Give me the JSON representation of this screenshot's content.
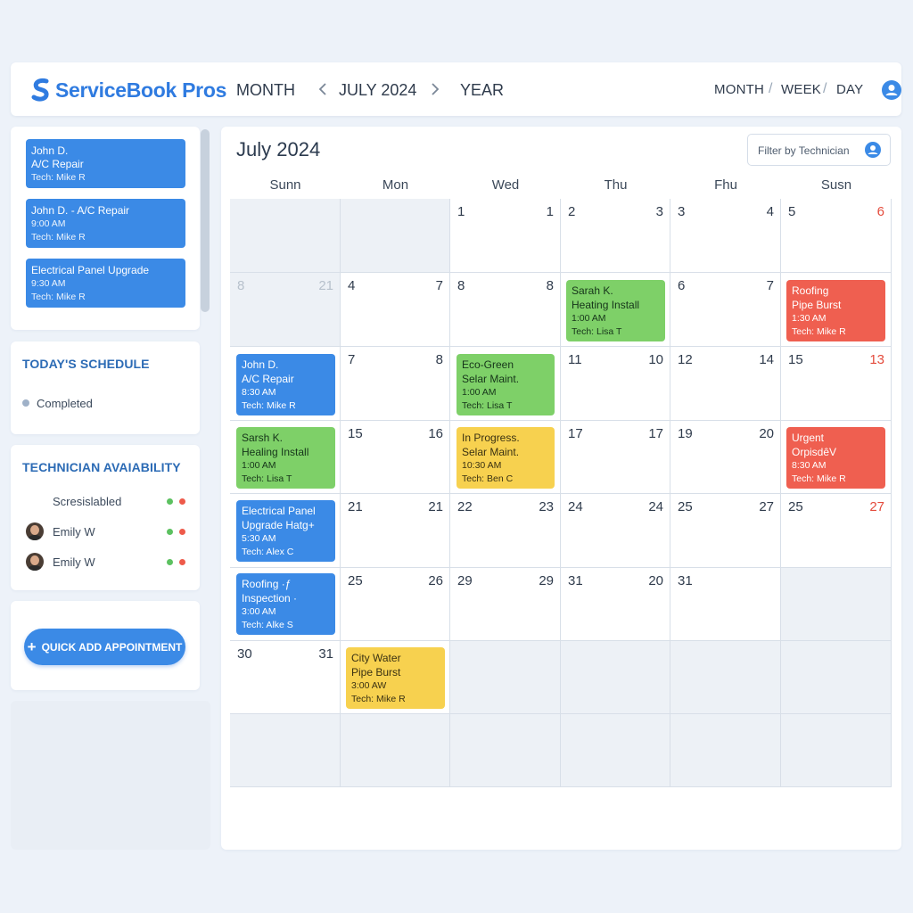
{
  "header": {
    "brand": "ServiceBook Pros",
    "nav_month": "MONTH",
    "nav_current": "JULY 2024",
    "nav_year": "YEAR",
    "view_month": "MONTH",
    "view_week": "WEEK",
    "view_day": "DAY",
    "separator": "/"
  },
  "sidebar": {
    "upcoming": [
      {
        "line1": "John D.",
        "line2": "A/C Repair",
        "line3": "Tech: Mike R"
      },
      {
        "line1": "John D. - A/C Repair",
        "line2": "9:00 AM",
        "line3": "Tech: Mike R"
      },
      {
        "line1": "Electrical Panel Upgrade",
        "line2": "9:30 AM",
        "line3": "Tech: Mike R"
      }
    ],
    "todays_schedule_title": "TODAY'S SCHEDULE",
    "status_completed": "Completed",
    "technician_title": "TECHNICIAN AVAIABILITY",
    "technicians": [
      {
        "name": "Scresislabled"
      },
      {
        "name": "Emily W"
      },
      {
        "name": "Emily W"
      }
    ],
    "quick_add": "QUICK ADD APPOINTMENT"
  },
  "calendar": {
    "title": "July 2024",
    "filter_label": "Filter by Technician",
    "days_of_week": [
      "Sunn",
      "Mon",
      "Wed",
      "Thu",
      "Fhu",
      "Susn"
    ],
    "cells": [
      {
        "l": "",
        "r": ""
      },
      {
        "l": "",
        "r": ""
      },
      {
        "l": "1",
        "r": "1"
      },
      {
        "l": "2",
        "r": "3"
      },
      {
        "l": "3",
        "r": "4"
      },
      {
        "l": "5",
        "r": "6"
      },
      {
        "l": "8",
        "r": "21"
      },
      {
        "l": "4",
        "r": "7"
      },
      {
        "l": "8",
        "r": "8"
      },
      {
        "l": "",
        "r": ""
      },
      {
        "l": "6",
        "r": "7"
      },
      {
        "l": "",
        "r": ""
      },
      {
        "l": "",
        "r": ""
      },
      {
        "l": "7",
        "r": "8"
      },
      {
        "l": "",
        "r": ""
      },
      {
        "l": "11",
        "r": "10"
      },
      {
        "l": "12",
        "r": "14"
      },
      {
        "l": "15",
        "r": "13"
      },
      {
        "l": "",
        "r": ""
      },
      {
        "l": "15",
        "r": "16"
      },
      {
        "l": "",
        "r": ""
      },
      {
        "l": "17",
        "r": "17"
      },
      {
        "l": "19",
        "r": "20"
      },
      {
        "l": "",
        "r": ""
      },
      {
        "l": "",
        "r": ""
      },
      {
        "l": "21",
        "r": "21"
      },
      {
        "l": "22",
        "r": "23"
      },
      {
        "l": "24",
        "r": "24"
      },
      {
        "l": "25",
        "r": "27"
      },
      {
        "l": "25",
        "r": "27"
      },
      {
        "l": "",
        "r": ""
      },
      {
        "l": "25",
        "r": "26"
      },
      {
        "l": "29",
        "r": "29"
      },
      {
        "l": "31",
        "r": "20"
      },
      {
        "l": "31",
        "r": ""
      },
      {
        "l": "",
        "r": ""
      },
      {
        "l": "30",
        "r": "31"
      },
      {
        "l": "",
        "r": ""
      },
      {
        "l": "",
        "r": ""
      },
      {
        "l": "",
        "r": ""
      },
      {
        "l": "",
        "r": ""
      },
      {
        "l": "",
        "r": ""
      }
    ],
    "events": [
      {
        "name": "ev-sarah-heating",
        "color": "green",
        "l1": "Sarah K.",
        "l2": "Heating Install",
        "l3": "1:00 AM",
        "l4": "Tech: Lisa T"
      },
      {
        "name": "ev-roofing-pipe",
        "color": "red",
        "l1": "Roofing",
        "l2": "Pipe Burst",
        "l3": "1:30 AM",
        "l4": "Tech: Mike R"
      },
      {
        "name": "ev-john-ac",
        "color": "blue",
        "l1": "John D.",
        "l2": "A/C Repair",
        "l3": "8:30 AM",
        "l4": "Tech: Mike R"
      },
      {
        "name": "ev-eco-green",
        "color": "green",
        "l1": "Eco-Green",
        "l2": "Selar Maint.",
        "l3": "1:00 AM",
        "l4": "Tech: Lisa T"
      },
      {
        "name": "ev-sarsh-healing",
        "color": "green",
        "l1": "Sarsh K.",
        "l2": "Healing Install",
        "l3": "1:00 AM",
        "l4": "Tech: Lisa T"
      },
      {
        "name": "ev-in-progress",
        "color": "yellow",
        "l1": "In Progress.",
        "l2": "Selar Maint.",
        "l3": "10:30 AM",
        "l4": "Tech: Ben C"
      },
      {
        "name": "ev-urgent",
        "color": "red",
        "l1": "Urgent",
        "l2": "OrpisdêV",
        "l3": "8:30 AM",
        "l4": "Tech: Mike R"
      },
      {
        "name": "ev-electrical-panel",
        "color": "blue",
        "l1": "Electrical Panel",
        "l2": "Upgrade Hatg+",
        "l3": "5:30 AM",
        "l4": "Tech: Alex C"
      },
      {
        "name": "ev-roofing-inspection",
        "color": "blue",
        "l1": "Roofing ·ƒ",
        "l2": "Inspection ·",
        "l3": "3:00 AM",
        "l4": "Tech: Alke S"
      },
      {
        "name": "ev-city-water",
        "color": "yellow",
        "l1": "City Water",
        "l2": "Pipe Burst",
        "l3": "3:00 AW",
        "l4": "Tech: Mike R"
      }
    ]
  },
  "colors": {
    "accent": "#3b8ae6",
    "brand": "#2f7be0",
    "green": "#7ed068",
    "yellow": "#f7d14f",
    "red": "#ef5f50",
    "status_completed": "#9fb1c8",
    "available": "#5cc160",
    "busy": "#ee5a4a"
  }
}
